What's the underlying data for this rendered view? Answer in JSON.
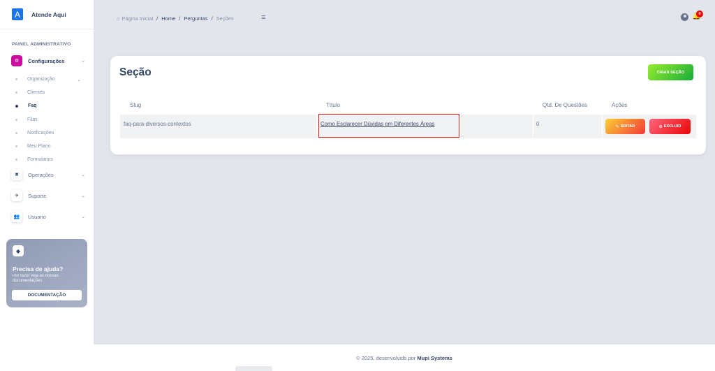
{
  "brand": {
    "logo": "A",
    "name": "Atende Aqui"
  },
  "sidebar": {
    "heading": "PAINEL ADMINISTRATIVO",
    "groups": [
      {
        "label": "Configurações",
        "icon": "settings-icon"
      },
      {
        "label": "Operações",
        "icon": "tools-icon"
      },
      {
        "label": "Suporte",
        "icon": "pin-icon"
      },
      {
        "label": "Usuario",
        "icon": "users-icon"
      }
    ],
    "sub_items": [
      {
        "label": "Organização"
      },
      {
        "label": "Clientes"
      },
      {
        "label": "Faq"
      },
      {
        "label": "Filas"
      },
      {
        "label": "Notificações"
      },
      {
        "label": "Meu Plano"
      },
      {
        "label": "Formularios"
      }
    ]
  },
  "help": {
    "title": "Precisa de ajuda?",
    "text": "Por favor veja as nossas documentações",
    "button": "DOCUMENTAÇÃO"
  },
  "breadcrumb": [
    "Página Inicial",
    "Home",
    "Perguntas",
    "Seções"
  ],
  "notifications": {
    "count": "0"
  },
  "card": {
    "title": "Seção",
    "create_button": "CRIAR SEÇÃO",
    "columns": [
      "Slug",
      "Título",
      "Qtd. De Questões",
      "Ações"
    ],
    "rows": [
      {
        "slug": "faq-para-diversos-contextos",
        "title": "Como Esclarecer Dúvidas em Diferentes Áreas",
        "count": "0"
      }
    ],
    "edit_button": "EDITAR",
    "delete_button": "EXCLUIR"
  },
  "footer": {
    "text": "© 2025, desenvolvido por",
    "company": "Mupi Systems"
  },
  "colors": {
    "accent": "#cb0c9f",
    "success": "#17ad37",
    "warning": "#fbcf33",
    "danger": "#ea0606",
    "highlight": "#e11d1d"
  }
}
